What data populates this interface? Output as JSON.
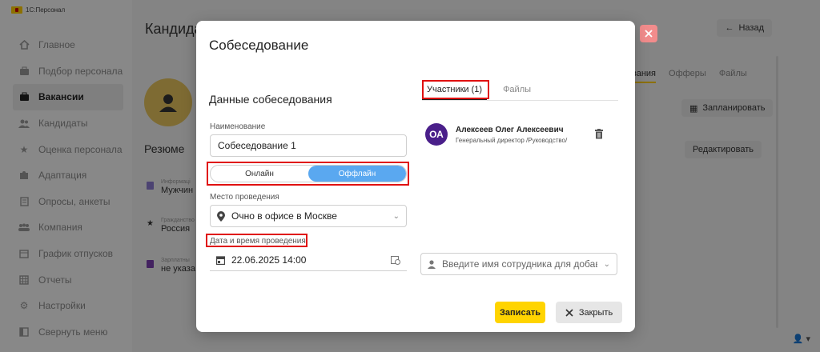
{
  "app": {
    "brand": "1С:Персонал"
  },
  "sidebar": {
    "items": [
      {
        "label": "Главное",
        "icon": "home-icon",
        "active": false
      },
      {
        "label": "Подбор персонала",
        "icon": "briefcase-icon",
        "active": false
      },
      {
        "label": "Вакансии",
        "icon": "briefcase-icon",
        "active": true
      },
      {
        "label": "Кандидаты",
        "icon": "people-icon",
        "active": false
      },
      {
        "label": "Оценка персонала",
        "icon": "star-icon",
        "active": false
      },
      {
        "label": "Адаптация",
        "icon": "puzzle-icon",
        "active": false
      },
      {
        "label": "Опросы, анкеты",
        "icon": "survey-icon",
        "active": false
      },
      {
        "label": "Компания",
        "icon": "company-icon",
        "active": false
      },
      {
        "label": "График отпусков",
        "icon": "calendar-icon",
        "active": false
      },
      {
        "label": "Отчеты",
        "icon": "table-icon",
        "active": false
      },
      {
        "label": "Настройки",
        "icon": "gear-icon",
        "active": false
      },
      {
        "label": "Свернуть меню",
        "icon": "collapse-icon",
        "active": false
      }
    ]
  },
  "background": {
    "page_title": "Кандида",
    "back_label": "Назад",
    "tabs": [
      "вания",
      "Офферы",
      "Файлы"
    ],
    "schedule_label": "Запланировать",
    "edit_label": "Редактировать",
    "resume_title": "Резюме",
    "info": [
      {
        "label": "Информаці",
        "value": "Мужчин"
      },
      {
        "label": "Гражданство",
        "value": "Россия"
      },
      {
        "label": "Зарплатны",
        "value": "не указа"
      }
    ]
  },
  "modal": {
    "title": "Собеседование",
    "section_title": "Данные собеседования",
    "name_label": "Наименование",
    "name_value": "Собеседование 1",
    "format": {
      "online": "Онлайн",
      "offline": "Оффлайн",
      "selected": "offline"
    },
    "place_label": "Место проведения",
    "place_value": "Очно в офисе в Москве",
    "datetime_label": "Дата и время проведения",
    "datetime_value": "22.06.2025 14:00",
    "tabs": {
      "participants": "Участники (1)",
      "files": "Файлы"
    },
    "participant": {
      "initials": "ОА",
      "name": "Алексеев Олег Алексеевич",
      "role": "Генеральный директор /Руководство/"
    },
    "employee_placeholder": "Введите имя сотрудника для добавления",
    "save_label": "Записать",
    "close_label": "Закрыть"
  },
  "colors": {
    "accent": "#ffd400",
    "toggle_on": "#5aa8f0",
    "highlight": "#e01010",
    "avatar": "#4a1f8a",
    "close_button": "#f28c8c"
  }
}
